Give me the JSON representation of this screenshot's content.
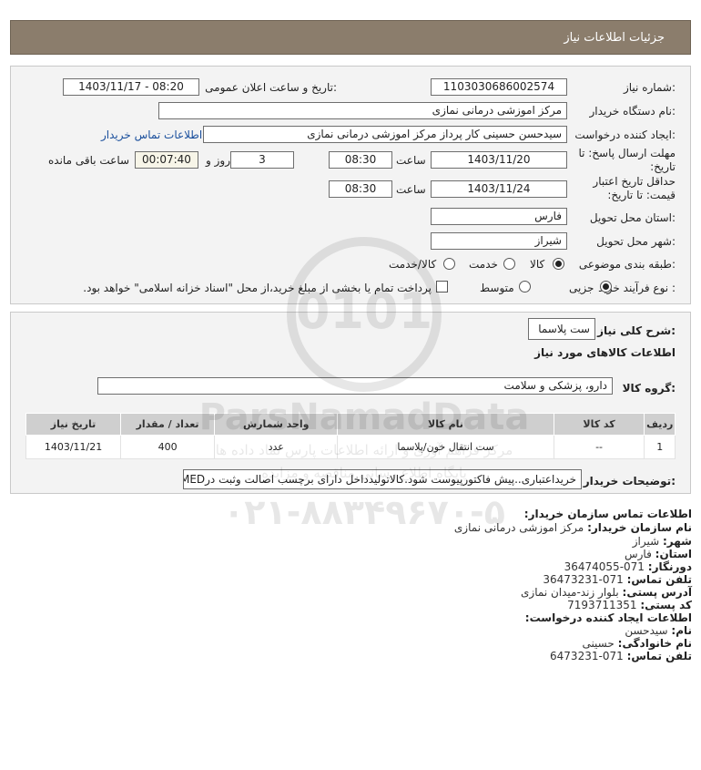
{
  "header": {
    "title": "جزئیات اطلاعات نیاز"
  },
  "form": {
    "need_number_label": "شماره نیاز:",
    "need_number": "1103030686002574",
    "announce_label": "تاریخ و ساعت اعلان عمومی:",
    "announce_value": "1403/11/17 - 08:20",
    "buyer_org_label": "نام دستگاه خریدار:",
    "buyer_org": "مرکز اموزشی درمانی نمازی",
    "creator_label": "ایجاد کننده درخواست:",
    "creator": "سیدحسن حسینی کار پرداز مرکز اموزشی درمانی نمازی",
    "contact_link": "اطلاعات تماس خریدار",
    "reply_deadline_label": "مهلت ارسال پاسخ: تا تاریخ:",
    "reply_date": "1403/11/20",
    "time_label": "ساعت",
    "reply_time": "08:30",
    "days": "3",
    "days_label": "روز و",
    "remaining": "00:07:40",
    "remaining_label": "ساعت باقی مانده",
    "validity_label": "حداقل تاریخ اعتبار قیمت: تا تاریخ:",
    "validity_date": "1403/11/24",
    "validity_time": "08:30",
    "province_label": "استان محل تحویل:",
    "province": "فارس",
    "city_label": "شهر محل تحویل:",
    "city": "شیراز",
    "category_label": "طبقه بندی موضوعی:",
    "category_options": [
      "کالا",
      "خدمت",
      "کالا/خدمت"
    ],
    "process_label": "نوع فرآیند خرید :",
    "process_options": [
      "جزیی",
      "متوسط"
    ],
    "payment_note": "پرداخت تمام یا بخشی از مبلغ خرید،از محل \"اسناد خزانه اسلامی\" خواهد بود."
  },
  "details": {
    "summary_label": "شرح کلی نیاز:",
    "summary": "ست پلاسما",
    "goods_info_title": "اطلاعات کالاهای مورد نیاز",
    "goods_group_label": "گروه کالا:",
    "goods_group": "دارو، پزشکی و سلامت",
    "table": {
      "headers": [
        "ردیف",
        "کد کالا",
        "نام کالا",
        "واحد شمارش",
        "تعداد / مقدار",
        "تاریخ نیاز"
      ],
      "rows": [
        [
          "1",
          "--",
          "ست انتقال خون/پلاسما",
          "عدد",
          "400",
          "1403/11/21"
        ]
      ]
    },
    "buyer_notes_label": "توضیحات خریدار:",
    "buyer_notes": "خریداعتباری..پیش فاکتورپیوست شود.کالاتولیدداخل دارای برچسب اصالت وثبت درIMED"
  },
  "contact": {
    "title": "اطلاعات تماس سازمان خریدار:",
    "org_label": "نام سازمان خریدار:",
    "org": "مرکز اموزشی درمانی نمازی",
    "city_label": "شهر:",
    "city": "شیراز",
    "province_label": "استان:",
    "province": "فارس",
    "fax_label": "دورنگار:",
    "fax": "071-36474055",
    "phone_label": "تلفن تماس:",
    "phone": "071-36473231",
    "address_label": "آدرس پستی:",
    "address": "بلوار زند-میدان نمازی",
    "postal_label": "کد پستی:",
    "postal": "7193711351",
    "creator_title": "اطلاعات ایجاد کننده درخواست:",
    "name_label": "نام:",
    "name": "سیدحسن",
    "family_label": "نام خانوادگی:",
    "family": "حسینی",
    "creator_phone_label": "تلفن تماس:",
    "creator_phone": "071-6473231"
  },
  "watermark": {
    "brand": "ParsNamadData",
    "line1": "مرکز فراهم آوری و ارائه اطلاعات پارس نماد داده ها",
    "line2": "پایگاه اطلاع رسانی مناقصه و مزایده",
    "phone": "۰۲۱-۸۸۳۴۹۶۷۰-۵"
  },
  "colors": {
    "header_bg": "#8b7d6c",
    "link": "#1a4f9c",
    "panel_bg": "#f3f3f3",
    "table_head": "#cfcfcf"
  }
}
